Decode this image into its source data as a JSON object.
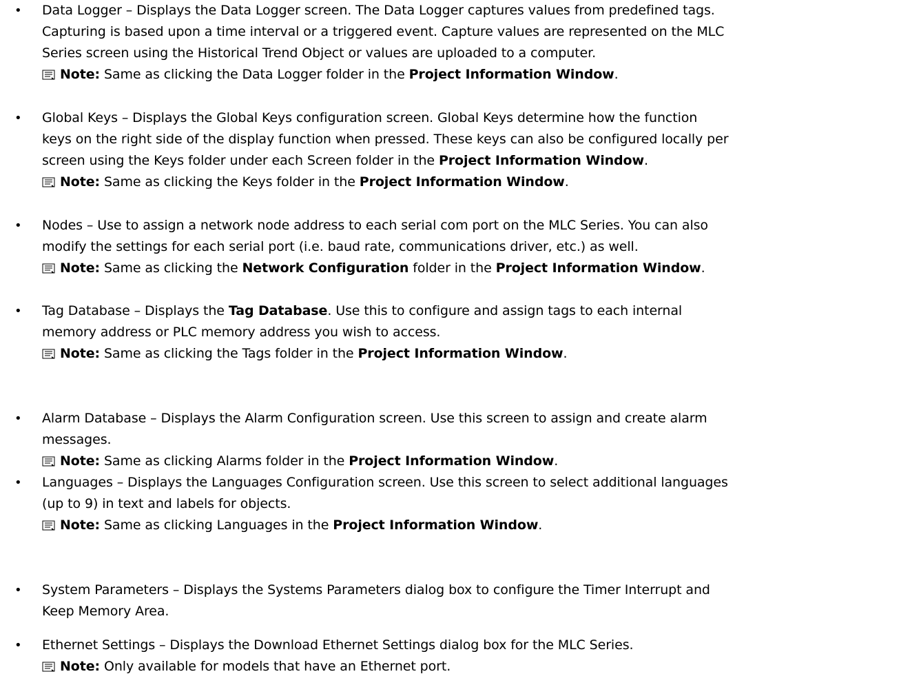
{
  "items": [
    {
      "lines": [
        "Data Logger – Displays the Data Logger screen. The Data Logger captures values from predefined tags.",
        "Capturing is based upon a time interval or a triggered event. Capture values are represented on the MLC",
        "Series screen using the Historical Trend Object or values are uploaded to a computer."
      ],
      "note": {
        "label": "Note:",
        "pre": " Same as clicking the Data Logger folder in the ",
        "b1": "Project Information Window",
        "post": "."
      }
    },
    {
      "lines": [
        "Global Keys – Displays the Global Keys configuration screen. Global Keys determine how the function",
        "keys on the right side of the display function when pressed. These keys can also be configured locally per"
      ],
      "line3": {
        "pre": "screen using the Keys folder under each Screen folder in the ",
        "b1": "Project Information Window",
        "post": "."
      },
      "note": {
        "label": "Note:",
        "pre": " Same as clicking the Keys folder in the ",
        "b1": "Project Information Window",
        "post": "."
      }
    },
    {
      "lines": [
        "Nodes – Use to assign a network node address to each serial com port on the MLC Series. You can also",
        "modify the settings for each serial port (i.e. baud rate, communications driver, etc.) as well."
      ],
      "note": {
        "label": "Note:",
        "pre": " Same as clicking the ",
        "b1": "Network Configuration",
        "mid": " folder in the ",
        "b2": "Project Information Window",
        "post": "."
      }
    },
    {
      "line1": {
        "pre": "Tag Database – Displays the ",
        "b1": "Tag Database",
        "post": ". Use this to configure and assign tags to each internal"
      },
      "lines": [
        "memory address or PLC memory address you wish to access."
      ],
      "note": {
        "label": "Note:",
        "pre": " Same as clicking the Tags folder in the ",
        "b1": "Project Information Window",
        "post": "."
      }
    },
    {
      "lines": [
        "Alarm Database – Displays the Alarm Configuration screen. Use this screen to assign and create alarm",
        "messages."
      ],
      "note": {
        "label": "Note:",
        "pre": " Same as clicking Alarms folder in the ",
        "b1": "Project Information Window",
        "post": "."
      }
    },
    {
      "lines": [
        "Languages – Displays the Languages Configuration screen. Use this screen to select additional languages",
        "(up to 9) in text and labels for objects."
      ],
      "note": {
        "label": "Note:",
        "pre": " Same as clicking Languages in the ",
        "b1": "Project Information Window",
        "post": "."
      }
    },
    {
      "lines": [
        "System Parameters – Displays the Systems Parameters dialog box to configure the Timer Interrupt and",
        "Keep Memory Area."
      ]
    },
    {
      "lines": [
        "Ethernet Settings – Displays the Download Ethernet Settings dialog box for the MLC Series."
      ],
      "note": {
        "label": "Note:",
        "pre": " Only available for models that have an Ethernet port."
      }
    }
  ],
  "bullet_glyph": "•",
  "icons": {
    "note": "note-icon"
  }
}
